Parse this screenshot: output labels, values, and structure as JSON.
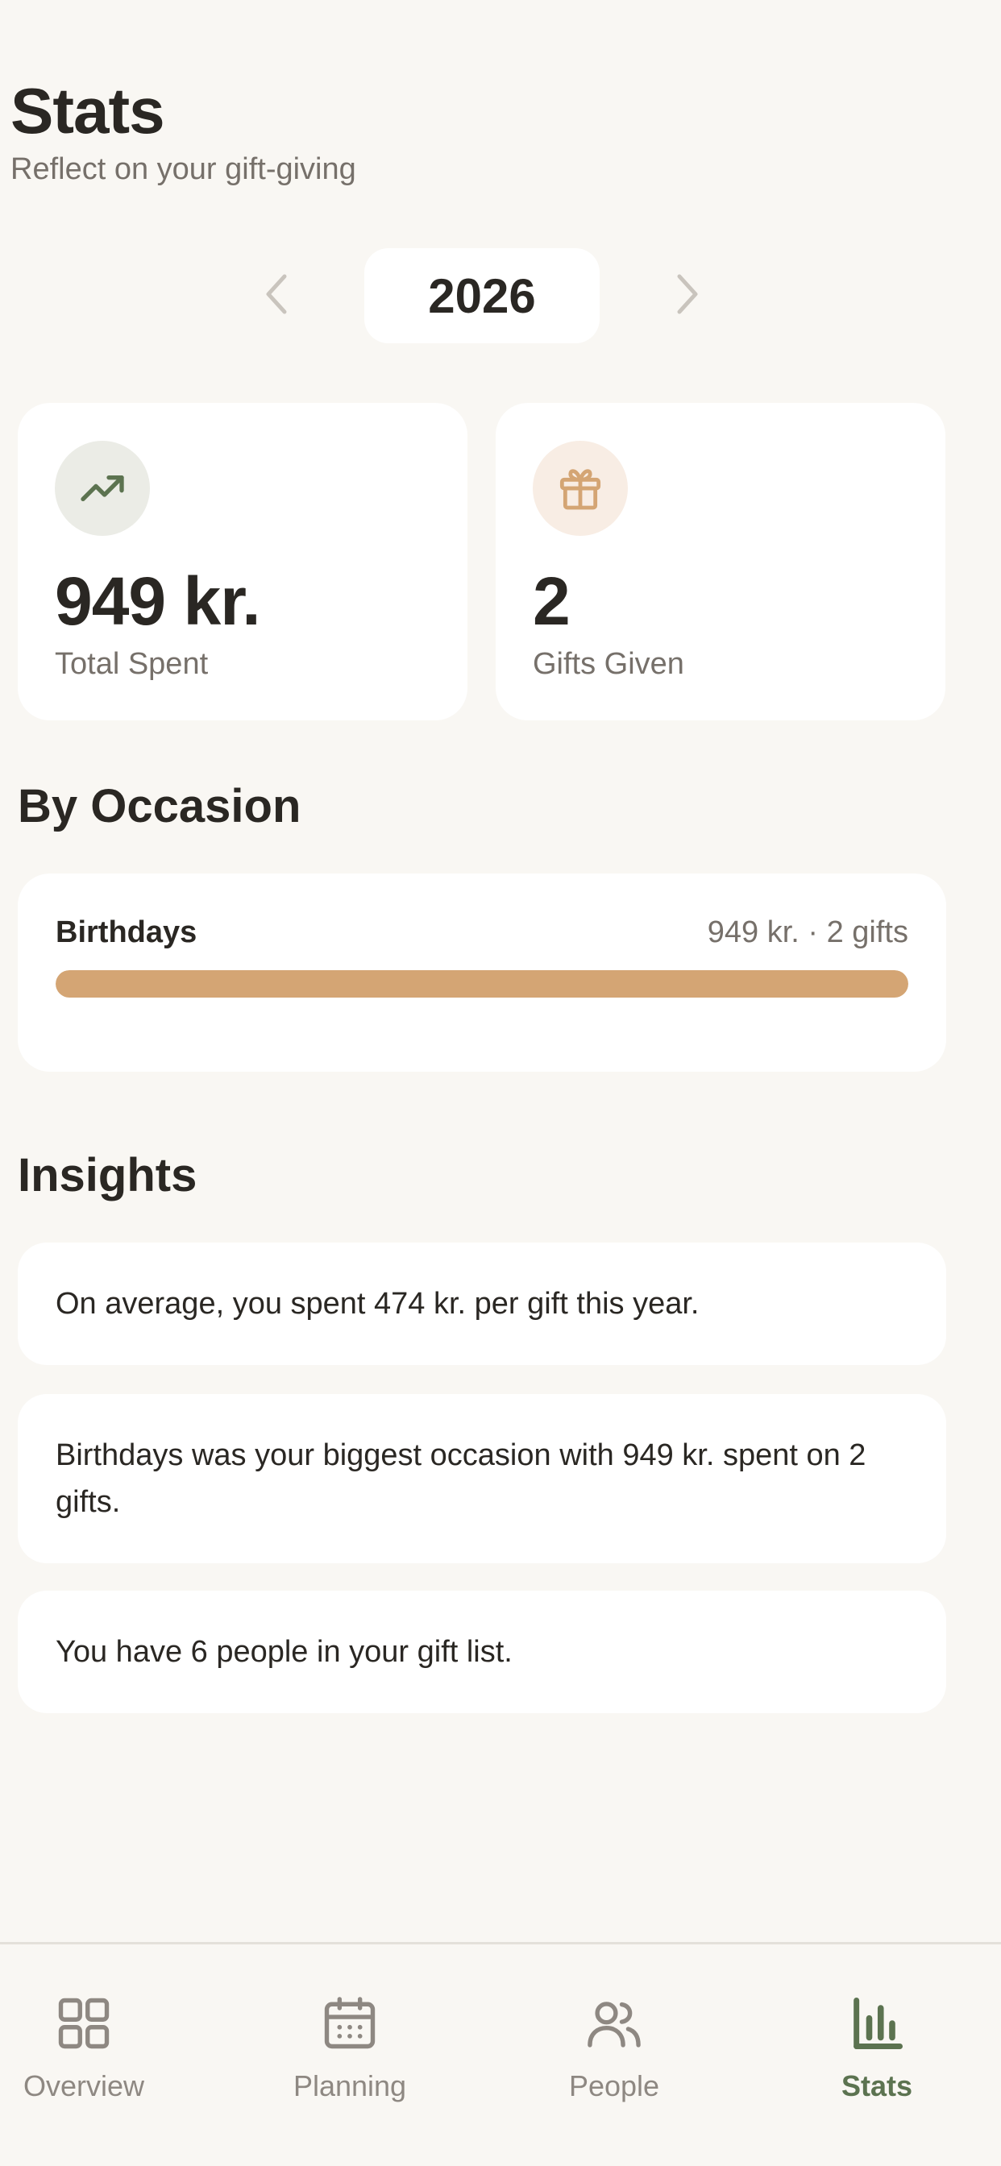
{
  "header": {
    "title": "Stats",
    "subtitle": "Reflect on your gift-giving"
  },
  "year_selector": {
    "year": "2026",
    "prev_icon": "chevron-left-icon",
    "next_icon": "chevron-right-icon"
  },
  "stats": [
    {
      "icon": "trending-up-icon",
      "value": "949 kr.",
      "label": "Total Spent"
    },
    {
      "icon": "gift-icon",
      "value": "2",
      "label": "Gifts Given"
    }
  ],
  "by_occasion": {
    "heading": "By Occasion",
    "items": [
      {
        "name": "Birthdays",
        "meta": "949 kr. · 2 gifts",
        "share": 1.0
      }
    ]
  },
  "insights": {
    "heading": "Insights",
    "items": [
      "On average, you spent 474 kr. per gift this year.",
      "Birthdays was your biggest occasion with 949 kr. spent on 2 gifts.",
      "You have 6 people in your gift list."
    ]
  },
  "tabbar": {
    "tabs": [
      {
        "label": "Overview",
        "icon": "grid-icon",
        "active": false
      },
      {
        "label": "Planning",
        "icon": "calendar-icon",
        "active": false
      },
      {
        "label": "People",
        "icon": "users-icon",
        "active": false
      },
      {
        "label": "Stats",
        "icon": "bar-chart-icon",
        "active": true
      }
    ]
  },
  "colors": {
    "background": "#f9f7f3",
    "card": "#ffffff",
    "accent_green": "#5c7350",
    "accent_tan": "#d4a574",
    "icon_bg_green": "#ebece6",
    "icon_bg_tan": "#f8ede4"
  }
}
